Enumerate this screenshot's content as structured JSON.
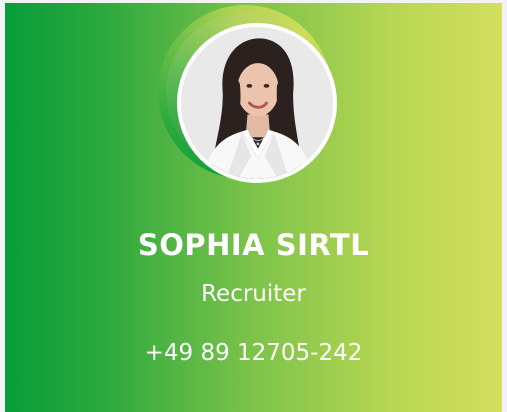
{
  "contact_card": {
    "name": "SOPHIA SIRTL",
    "role": "Recruiter",
    "phone": "+49 89 12705-242",
    "photo_alt": "avatar-photo"
  },
  "colors": {
    "gradient_start": "#069d3a",
    "gradient_end": "#d3df5d",
    "text": "#ffffff"
  }
}
